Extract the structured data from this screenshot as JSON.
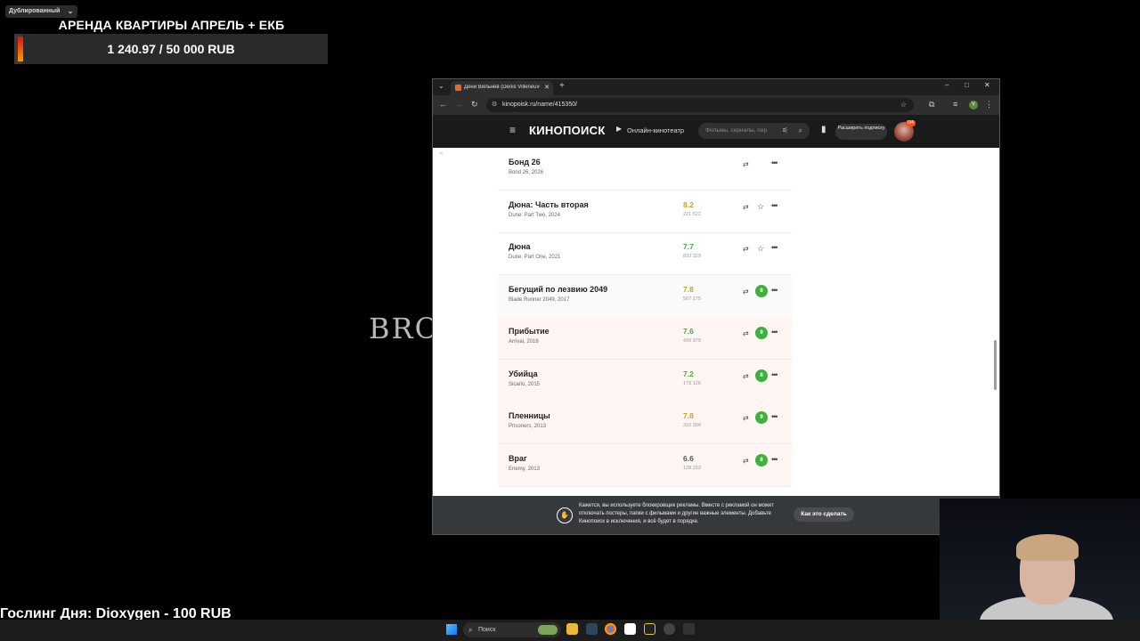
{
  "overlay": {
    "dub_label": "Дублированный",
    "goal_title": "АРЕНДА КВАРТИРЫ АПРЕЛЬ + ЕКБ",
    "goal_progress_text": "1 240.97 / 50 000 RUB",
    "goal_progress": 0.0248,
    "background_word": "BRO",
    "donor_line": "Гослинг Дня: Dioxygen - 100 RUB"
  },
  "browser": {
    "tab_title": "Дени Вильнёв (Denis Villeneuve)",
    "url": "kinopoisk.ru/name/415350/"
  },
  "header": {
    "logo": "КИНОПОИСК",
    "online": "Онлайн-кинотеатр",
    "search_placeholder": "Фильмы, сериалы, пер",
    "subscribe": "Расширить подписку",
    "avatar_badge": "0/4"
  },
  "films": [
    {
      "title": "Бонд 26",
      "sub": "Bond 26, 2026",
      "rating": "",
      "votes": "",
      "rating_style": "none",
      "grade": "",
      "bg": "white"
    },
    {
      "title": "Дюна: Часть вторая",
      "sub": "Dune: Part Two, 2024",
      "rating": "8.2",
      "votes": "221 522",
      "rating_style": "gold",
      "grade": "",
      "bg": "white"
    },
    {
      "title": "Дюна",
      "sub": "Dune: Part One, 2021",
      "rating": "7.7",
      "votes": "833 329",
      "rating_style": "green",
      "grade": "",
      "bg": "white"
    },
    {
      "title": "Бегущий по лезвию 2049",
      "sub": "Blade Runner 2049, 2017",
      "rating": "7.8",
      "votes": "507 275",
      "rating_style": "gold",
      "grade": "8",
      "bg": "light"
    },
    {
      "title": "Прибытие",
      "sub": "Arrival, 2016",
      "rating": "7.6",
      "votes": "439 979",
      "rating_style": "green",
      "grade": "9",
      "bg": "pink"
    },
    {
      "title": "Убийца",
      "sub": "Sicario, 2015",
      "rating": "7.2",
      "votes": "179 126",
      "rating_style": "green",
      "grade": "8",
      "bg": "pink"
    },
    {
      "title": "Пленницы",
      "sub": "Prisoners, 2013",
      "rating": "7.8",
      "votes": "316 304",
      "rating_style": "gold",
      "grade": "9",
      "bg": "pink"
    },
    {
      "title": "Враг",
      "sub": "Enemy, 2013",
      "rating": "6.6",
      "votes": "128 253",
      "rating_style": "gray",
      "grade": "8",
      "bg": "pink"
    }
  ],
  "adblock": {
    "text": "Кажется, вы используете блокировщик рекламы. Вместе с рекламой он может отключать постеры, папки с фильмами и другие важные элементы. Добавьте Кинопоиск в исключения, и всё будет в порядке.",
    "button": "Как это сделать"
  },
  "taskbar": {
    "search": "Поиск"
  },
  "colors": {
    "green_rating": "#3bb33b",
    "gold_rating": "#c9a227",
    "header_bg": "#1a1a1a",
    "accent_orange": "#ff4f00"
  }
}
